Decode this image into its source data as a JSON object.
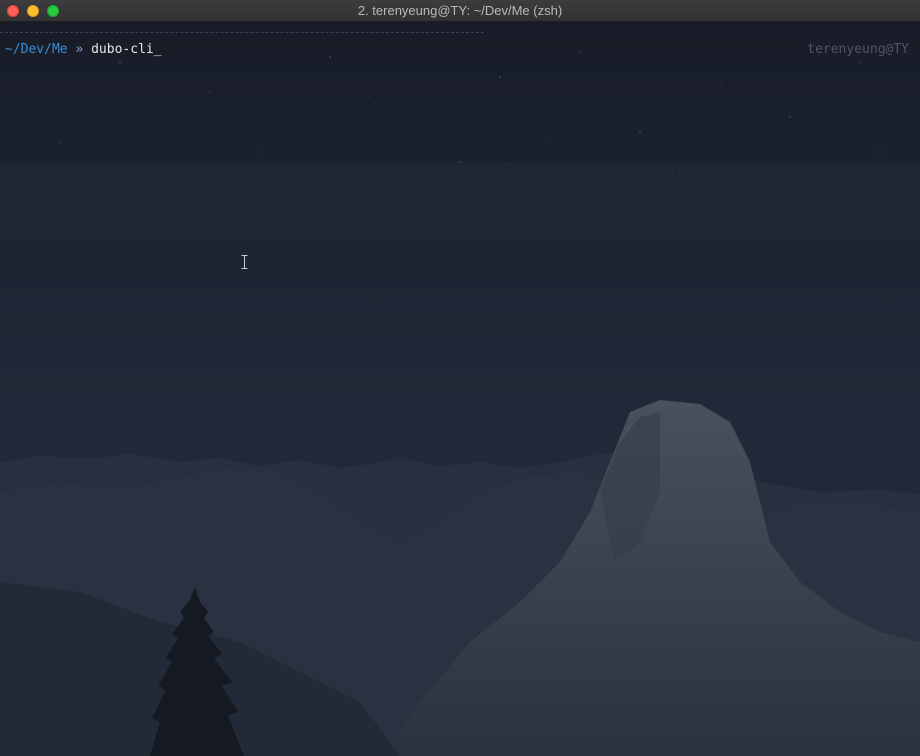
{
  "window": {
    "title": "2. terenyeung@TY: ~/Dev/Me (zsh)"
  },
  "terminal": {
    "prompt_path": "~/Dev/Me",
    "prompt_separator": " » ",
    "command": "dubo-cli",
    "cursor": "_",
    "right_prompt": "terenyeung@TY"
  },
  "colors": {
    "prompt_path": "#3d8fd6",
    "command_text": "#e6e6e6",
    "right_prompt": "#4e5563",
    "background": "#1a1f2b"
  },
  "icons": {
    "close": "close-icon",
    "minimize": "minimize-icon",
    "zoom": "zoom-icon",
    "mouse_cursor": "ibeam-cursor-icon"
  }
}
